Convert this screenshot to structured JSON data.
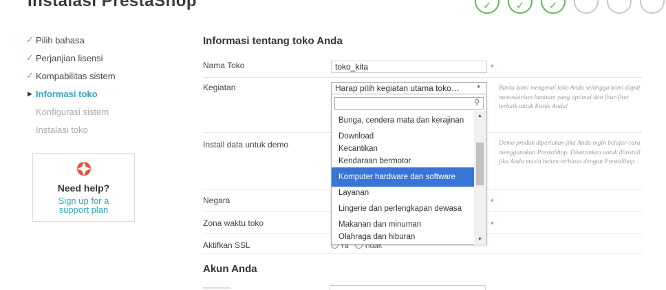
{
  "app_title": "Instalasi PrestaShop",
  "steps": [
    {
      "state": "done"
    },
    {
      "state": "done"
    },
    {
      "state": "done"
    },
    {
      "state": "pending"
    },
    {
      "state": "pending"
    },
    {
      "state": "pending"
    }
  ],
  "sidebar": {
    "items": [
      {
        "label": "Pilih bahasa",
        "state": "done"
      },
      {
        "label": "Perjanjian lisensi",
        "state": "done"
      },
      {
        "label": "Kompabilitas sistem",
        "state": "done"
      },
      {
        "label": "Informasi toko",
        "state": "current"
      },
      {
        "label": "Konfigurasi sistem",
        "state": "pending"
      },
      {
        "label": "Instalasi toko",
        "state": "pending"
      }
    ]
  },
  "help": {
    "title": "Need help?",
    "link": "Sign up for a support plan",
    "icon": "lifebuoy-icon"
  },
  "form": {
    "section_title": "Informasi tentang toko Anda",
    "shop_name": {
      "label": "Nama Toko",
      "value": "toko_kita",
      "required": "*"
    },
    "activity": {
      "label": "Kegiatan",
      "selected": "Harap pilih kegiatan utama toko…",
      "hint": "Bantu kami mengenal toko Anda sehingga kami dapat menawarkan bantuan yang optimal dan fitur-fitur terbaik untuk bisnis Anda!",
      "search_value": "",
      "options": [
        "Bunga, cendera mata dan kerajinan",
        "Download",
        "Kecantikan",
        "Kendaraan bermotor",
        "Komputer hardware dan software",
        "Layanan",
        "Lingerie dan perlengkapan dewasa",
        "Makanan dan minuman",
        "Olahraga dan hiburan"
      ],
      "highlighted": "Komputer hardware dan software"
    },
    "demo": {
      "label": "Install data untuk demo",
      "hint": "Demo produk diperlukan jika Anda ingin belajar cara menggunakan PrestaShop. Disarankan untuk diinstall jika Anda masih belum terbiasa dengan PrestaShop."
    },
    "country": {
      "label": "Negara",
      "required": "*"
    },
    "timezone": {
      "label": "Zona waktu toko",
      "required": "*"
    },
    "ssl": {
      "label": "Aktifkan SSL",
      "options": [
        "Ya",
        "Tidak"
      ]
    }
  },
  "account": {
    "section_title": "Akun Anda"
  },
  "colors": {
    "accent": "#2ea6c7",
    "done": "#5cb85c",
    "highlight": "#3875d7",
    "required": "#d9534f"
  }
}
